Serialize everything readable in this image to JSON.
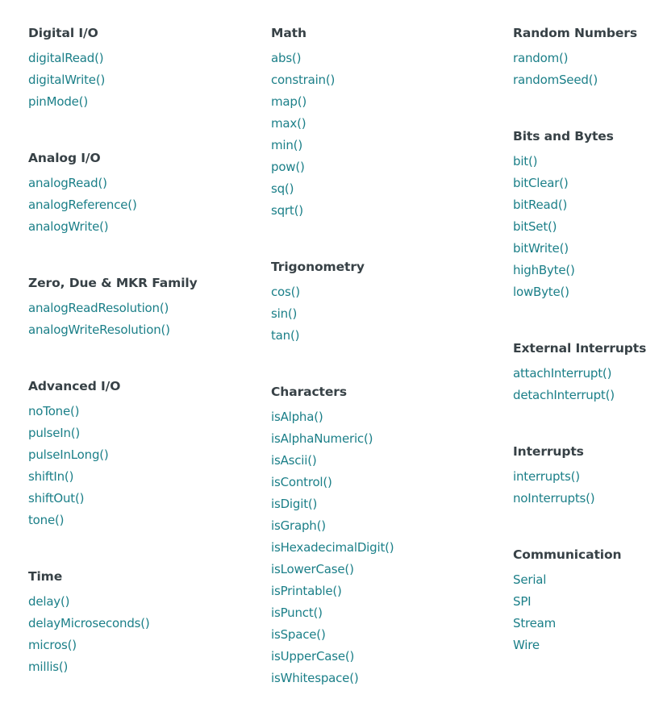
{
  "colors": {
    "link": "#1b7f88",
    "heading": "#374146"
  },
  "columns": [
    [
      {
        "title": "Digital I/O",
        "items": [
          "digitalRead()",
          "digitalWrite()",
          "pinMode()"
        ]
      },
      {
        "title": "Analog I/O",
        "items": [
          "analogRead()",
          "analogReference()",
          "analogWrite()"
        ]
      },
      {
        "title": "Zero, Due & MKR Family",
        "items": [
          "analogReadResolution()",
          "analogWriteResolution()"
        ]
      },
      {
        "title": "Advanced I/O",
        "items": [
          "noTone()",
          "pulseIn()",
          "pulseInLong()",
          "shiftIn()",
          "shiftOut()",
          "tone()"
        ]
      },
      {
        "title": "Time",
        "items": [
          "delay()",
          "delayMicroseconds()",
          "micros()",
          "millis()"
        ]
      }
    ],
    [
      {
        "title": "Math",
        "items": [
          "abs()",
          "constrain()",
          "map()",
          "max()",
          "min()",
          "pow()",
          "sq()",
          "sqrt()"
        ]
      },
      {
        "title": "Trigonometry",
        "items": [
          "cos()",
          "sin()",
          "tan()"
        ]
      },
      {
        "title": "Characters",
        "items": [
          "isAlpha()",
          "isAlphaNumeric()",
          "isAscii()",
          "isControl()",
          "isDigit()",
          "isGraph()",
          "isHexadecimalDigit()",
          "isLowerCase()",
          "isPrintable()",
          "isPunct()",
          "isSpace()",
          "isUpperCase()",
          "isWhitespace()"
        ]
      }
    ],
    [
      {
        "title": "Random Numbers",
        "items": [
          "random()",
          "randomSeed()"
        ]
      },
      {
        "title": "Bits and Bytes",
        "items": [
          "bit()",
          "bitClear()",
          "bitRead()",
          "bitSet()",
          "bitWrite()",
          "highByte()",
          "lowByte()"
        ]
      },
      {
        "title": "External Interrupts",
        "items": [
          "attachInterrupt()",
          "detachInterrupt()"
        ]
      },
      {
        "title": "Interrupts",
        "items": [
          "interrupts()",
          "noInterrupts()"
        ]
      },
      {
        "title": "Communication",
        "items": [
          "Serial",
          "SPI",
          "Stream",
          "Wire"
        ]
      }
    ]
  ]
}
